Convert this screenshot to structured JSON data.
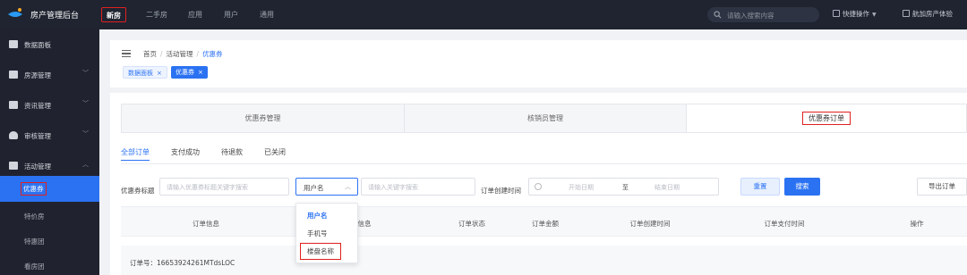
{
  "app": {
    "title": "房产管理后台"
  },
  "topnav": {
    "items": [
      "新房",
      "二手房",
      "应用",
      "用户",
      "通用"
    ]
  },
  "search": {
    "placeholder": "请输入搜索内容"
  },
  "header_actions": {
    "quick": "快捷操作",
    "company": "航加房产体验"
  },
  "sidebar": {
    "items": [
      {
        "label": "数据面板",
        "icon": "chart-icon"
      },
      {
        "label": "房源管理",
        "icon": "building-icon"
      },
      {
        "label": "资讯管理",
        "icon": "news-icon"
      },
      {
        "label": "审核管理",
        "icon": "user-icon"
      },
      {
        "label": "活动管理",
        "icon": "gift-icon"
      }
    ],
    "subitems": [
      "优惠券",
      "特价房",
      "特惠团",
      "看房团"
    ]
  },
  "breadcrumb": {
    "items": [
      "首页",
      "活动管理",
      "优惠券"
    ]
  },
  "tags": [
    {
      "label": "数据面板"
    },
    {
      "label": "优惠券"
    }
  ],
  "segment_tabs": [
    "优惠券管理",
    "核销员管理",
    "优惠券订单"
  ],
  "sub_tabs": [
    "全部订单",
    "支付成功",
    "待退款",
    "已关闭"
  ],
  "filters": {
    "coupon_title_label": "优惠券标题",
    "coupon_title_placeholder": "请输入优惠券标题关键字搜索",
    "user_field_value": "用户名",
    "keyword_placeholder": "请输入关键字搜索",
    "created_time_label": "订单创建时间",
    "start_date_placeholder": "开始日期",
    "range_sep": "至",
    "end_date_placeholder": "结束日期",
    "reset": "重置",
    "search": "搜索",
    "export": "导出订单"
  },
  "table": {
    "columns": [
      "订单信息",
      "信息",
      "订单状态",
      "订单金额",
      "订单创建时间",
      "订单支付时间",
      "操作"
    ]
  },
  "order": {
    "number_text": "订单号：16653924261MTdsLOC"
  },
  "dropdown": {
    "options": [
      "用户名",
      "手机号",
      "楼盘名称"
    ]
  }
}
